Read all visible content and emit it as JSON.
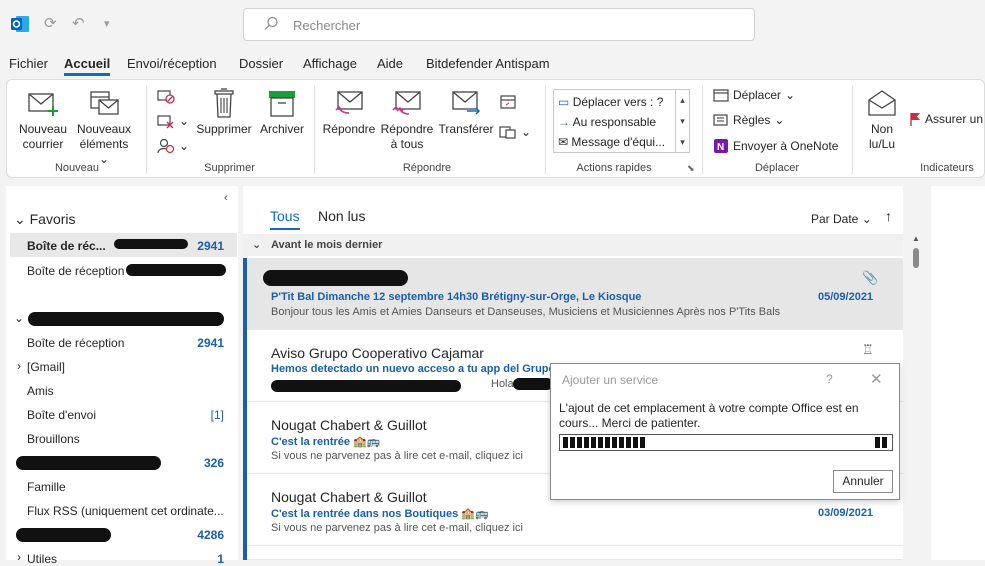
{
  "titlebar": {
    "search_placeholder": "Rechercher"
  },
  "menu": [
    "Fichier",
    "Accueil",
    "Envoi/réception",
    "Dossier",
    "Affichage",
    "Aide",
    "Bitdefender Antispam"
  ],
  "ribbon": {
    "nouveau_courrier": [
      "Nouveau",
      "courrier"
    ],
    "nouveaux_elements": [
      "Nouveaux",
      "éléments"
    ],
    "supprimer": "Supprimer",
    "archiver": "Archiver",
    "repondre": "Répondre",
    "repondre_tous": [
      "Répondre",
      "à tous"
    ],
    "transferer": "Transférer",
    "quick_steps": [
      "Déplacer vers : ?",
      "Au responsable",
      "Message d'équi..."
    ],
    "deplacer": "Déplacer",
    "regles": "Règles",
    "onenote": "Envoyer à OneNote",
    "non_lu": [
      "Non",
      "lu/Lu"
    ],
    "assurer": "Assurer un",
    "groups": [
      "Nouveau",
      "Supprimer",
      "Répondre",
      "Actions rapides",
      "Déplacer",
      "Indicateurs"
    ]
  },
  "sidebar": {
    "favoris": "Favoris",
    "fav_items": [
      {
        "label": "Boîte de réc...",
        "count": "2941"
      },
      {
        "label": "Boîte de réception",
        "count": ""
      }
    ],
    "account_items": [
      {
        "label": "Boîte de réception",
        "count": "2941"
      },
      {
        "label": "[Gmail]",
        "count": ""
      },
      {
        "label": "Amis",
        "count": ""
      },
      {
        "label": "Boîte d'envoi",
        "count": "[1]"
      },
      {
        "label": "Brouillons",
        "count": ""
      },
      {
        "label": "",
        "count": "326"
      },
      {
        "label": "Famille",
        "count": ""
      },
      {
        "label": "Flux RSS (uniquement cet ordinate...",
        "count": ""
      },
      {
        "label": "",
        "count": "4286"
      },
      {
        "label": "Utiles",
        "count": "1"
      }
    ]
  },
  "maillist": {
    "tabs": [
      "Tous",
      "Non lus"
    ],
    "sort": "Par Date",
    "group_header": "Avant le mois dernier",
    "mails": [
      {
        "from": "",
        "subject": "P'Tit Bal Dimanche 12 septembre 14h30 Brétigny-sur-Orge, Le Kiosque",
        "preview": "Bonjour tous les Amis et Amies Danseurs et Danseuses, Musiciens et Musiciennes  Après nos P'Tits Bals",
        "date": "05/09/2021",
        "icon": "attachment-icon"
      },
      {
        "from": "Aviso Grupo Cooperativo Cajamar",
        "subject": "Hemos detectado un nuevo acceso a tu app del Grupo",
        "preview": "Hola",
        "date": "",
        "icon": "reminder-icon"
      },
      {
        "from": "Nougat Chabert & Guillot",
        "subject": "C'est la rentrée",
        "preview": "Si vous ne parvenez pas à lire cet e-mail, cliquez ici",
        "date": "",
        "icon": ""
      },
      {
        "from": "Nougat Chabert & Guillot",
        "subject": "C'est la rentrée dans nos Boutiques",
        "preview": "Si vous ne parvenez pas à lire cet e-mail, cliquez ici",
        "date": "03/09/2021",
        "icon": ""
      }
    ]
  },
  "dialog": {
    "title": "Ajouter un service",
    "help": "?",
    "message": "L'ajout de cet emplacement à votre compte Office est en cours... Merci de patienter.",
    "cancel": "Annuler"
  },
  "colors": {
    "accent": "#0f6cbd",
    "link": "#1a5fa8"
  }
}
